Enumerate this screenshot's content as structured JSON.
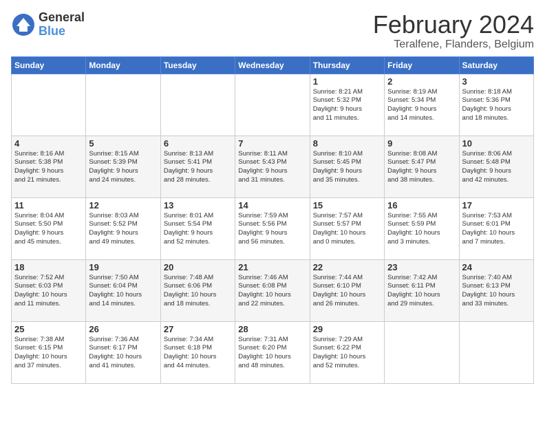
{
  "logo": {
    "general": "General",
    "blue": "Blue"
  },
  "title": "February 2024",
  "subtitle": "Teralfene, Flanders, Belgium",
  "days": [
    "Sunday",
    "Monday",
    "Tuesday",
    "Wednesday",
    "Thursday",
    "Friday",
    "Saturday"
  ],
  "weeks": [
    [
      {
        "day": "",
        "info": ""
      },
      {
        "day": "",
        "info": ""
      },
      {
        "day": "",
        "info": ""
      },
      {
        "day": "",
        "info": ""
      },
      {
        "day": "1",
        "info": "Sunrise: 8:21 AM\nSunset: 5:32 PM\nDaylight: 9 hours\nand 11 minutes."
      },
      {
        "day": "2",
        "info": "Sunrise: 8:19 AM\nSunset: 5:34 PM\nDaylight: 9 hours\nand 14 minutes."
      },
      {
        "day": "3",
        "info": "Sunrise: 8:18 AM\nSunset: 5:36 PM\nDaylight: 9 hours\nand 18 minutes."
      }
    ],
    [
      {
        "day": "4",
        "info": "Sunrise: 8:16 AM\nSunset: 5:38 PM\nDaylight: 9 hours\nand 21 minutes."
      },
      {
        "day": "5",
        "info": "Sunrise: 8:15 AM\nSunset: 5:39 PM\nDaylight: 9 hours\nand 24 minutes."
      },
      {
        "day": "6",
        "info": "Sunrise: 8:13 AM\nSunset: 5:41 PM\nDaylight: 9 hours\nand 28 minutes."
      },
      {
        "day": "7",
        "info": "Sunrise: 8:11 AM\nSunset: 5:43 PM\nDaylight: 9 hours\nand 31 minutes."
      },
      {
        "day": "8",
        "info": "Sunrise: 8:10 AM\nSunset: 5:45 PM\nDaylight: 9 hours\nand 35 minutes."
      },
      {
        "day": "9",
        "info": "Sunrise: 8:08 AM\nSunset: 5:47 PM\nDaylight: 9 hours\nand 38 minutes."
      },
      {
        "day": "10",
        "info": "Sunrise: 8:06 AM\nSunset: 5:48 PM\nDaylight: 9 hours\nand 42 minutes."
      }
    ],
    [
      {
        "day": "11",
        "info": "Sunrise: 8:04 AM\nSunset: 5:50 PM\nDaylight: 9 hours\nand 45 minutes."
      },
      {
        "day": "12",
        "info": "Sunrise: 8:03 AM\nSunset: 5:52 PM\nDaylight: 9 hours\nand 49 minutes."
      },
      {
        "day": "13",
        "info": "Sunrise: 8:01 AM\nSunset: 5:54 PM\nDaylight: 9 hours\nand 52 minutes."
      },
      {
        "day": "14",
        "info": "Sunrise: 7:59 AM\nSunset: 5:56 PM\nDaylight: 9 hours\nand 56 minutes."
      },
      {
        "day": "15",
        "info": "Sunrise: 7:57 AM\nSunset: 5:57 PM\nDaylight: 10 hours\nand 0 minutes."
      },
      {
        "day": "16",
        "info": "Sunrise: 7:55 AM\nSunset: 5:59 PM\nDaylight: 10 hours\nand 3 minutes."
      },
      {
        "day": "17",
        "info": "Sunrise: 7:53 AM\nSunset: 6:01 PM\nDaylight: 10 hours\nand 7 minutes."
      }
    ],
    [
      {
        "day": "18",
        "info": "Sunrise: 7:52 AM\nSunset: 6:03 PM\nDaylight: 10 hours\nand 11 minutes."
      },
      {
        "day": "19",
        "info": "Sunrise: 7:50 AM\nSunset: 6:04 PM\nDaylight: 10 hours\nand 14 minutes."
      },
      {
        "day": "20",
        "info": "Sunrise: 7:48 AM\nSunset: 6:06 PM\nDaylight: 10 hours\nand 18 minutes."
      },
      {
        "day": "21",
        "info": "Sunrise: 7:46 AM\nSunset: 6:08 PM\nDaylight: 10 hours\nand 22 minutes."
      },
      {
        "day": "22",
        "info": "Sunrise: 7:44 AM\nSunset: 6:10 PM\nDaylight: 10 hours\nand 26 minutes."
      },
      {
        "day": "23",
        "info": "Sunrise: 7:42 AM\nSunset: 6:11 PM\nDaylight: 10 hours\nand 29 minutes."
      },
      {
        "day": "24",
        "info": "Sunrise: 7:40 AM\nSunset: 6:13 PM\nDaylight: 10 hours\nand 33 minutes."
      }
    ],
    [
      {
        "day": "25",
        "info": "Sunrise: 7:38 AM\nSunset: 6:15 PM\nDaylight: 10 hours\nand 37 minutes."
      },
      {
        "day": "26",
        "info": "Sunrise: 7:36 AM\nSunset: 6:17 PM\nDaylight: 10 hours\nand 41 minutes."
      },
      {
        "day": "27",
        "info": "Sunrise: 7:34 AM\nSunset: 6:18 PM\nDaylight: 10 hours\nand 44 minutes."
      },
      {
        "day": "28",
        "info": "Sunrise: 7:31 AM\nSunset: 6:20 PM\nDaylight: 10 hours\nand 48 minutes."
      },
      {
        "day": "29",
        "info": "Sunrise: 7:29 AM\nSunset: 6:22 PM\nDaylight: 10 hours\nand 52 minutes."
      },
      {
        "day": "",
        "info": ""
      },
      {
        "day": "",
        "info": ""
      }
    ]
  ]
}
